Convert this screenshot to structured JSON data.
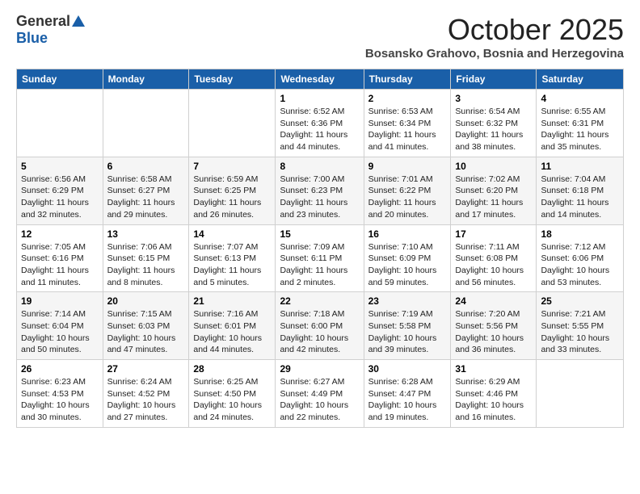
{
  "header": {
    "logo_general": "General",
    "logo_blue": "Blue",
    "month_title": "October 2025",
    "subtitle": "Bosansko Grahovo, Bosnia and Herzegovina"
  },
  "weekdays": [
    "Sunday",
    "Monday",
    "Tuesday",
    "Wednesday",
    "Thursday",
    "Friday",
    "Saturday"
  ],
  "weeks": [
    [
      {
        "day": "",
        "sunrise": "",
        "sunset": "",
        "daylight": ""
      },
      {
        "day": "",
        "sunrise": "",
        "sunset": "",
        "daylight": ""
      },
      {
        "day": "",
        "sunrise": "",
        "sunset": "",
        "daylight": ""
      },
      {
        "day": "1",
        "sunrise": "Sunrise: 6:52 AM",
        "sunset": "Sunset: 6:36 PM",
        "daylight": "Daylight: 11 hours and 44 minutes."
      },
      {
        "day": "2",
        "sunrise": "Sunrise: 6:53 AM",
        "sunset": "Sunset: 6:34 PM",
        "daylight": "Daylight: 11 hours and 41 minutes."
      },
      {
        "day": "3",
        "sunrise": "Sunrise: 6:54 AM",
        "sunset": "Sunset: 6:32 PM",
        "daylight": "Daylight: 11 hours and 38 minutes."
      },
      {
        "day": "4",
        "sunrise": "Sunrise: 6:55 AM",
        "sunset": "Sunset: 6:31 PM",
        "daylight": "Daylight: 11 hours and 35 minutes."
      }
    ],
    [
      {
        "day": "5",
        "sunrise": "Sunrise: 6:56 AM",
        "sunset": "Sunset: 6:29 PM",
        "daylight": "Daylight: 11 hours and 32 minutes."
      },
      {
        "day": "6",
        "sunrise": "Sunrise: 6:58 AM",
        "sunset": "Sunset: 6:27 PM",
        "daylight": "Daylight: 11 hours and 29 minutes."
      },
      {
        "day": "7",
        "sunrise": "Sunrise: 6:59 AM",
        "sunset": "Sunset: 6:25 PM",
        "daylight": "Daylight: 11 hours and 26 minutes."
      },
      {
        "day": "8",
        "sunrise": "Sunrise: 7:00 AM",
        "sunset": "Sunset: 6:23 PM",
        "daylight": "Daylight: 11 hours and 23 minutes."
      },
      {
        "day": "9",
        "sunrise": "Sunrise: 7:01 AM",
        "sunset": "Sunset: 6:22 PM",
        "daylight": "Daylight: 11 hours and 20 minutes."
      },
      {
        "day": "10",
        "sunrise": "Sunrise: 7:02 AM",
        "sunset": "Sunset: 6:20 PM",
        "daylight": "Daylight: 11 hours and 17 minutes."
      },
      {
        "day": "11",
        "sunrise": "Sunrise: 7:04 AM",
        "sunset": "Sunset: 6:18 PM",
        "daylight": "Daylight: 11 hours and 14 minutes."
      }
    ],
    [
      {
        "day": "12",
        "sunrise": "Sunrise: 7:05 AM",
        "sunset": "Sunset: 6:16 PM",
        "daylight": "Daylight: 11 hours and 11 minutes."
      },
      {
        "day": "13",
        "sunrise": "Sunrise: 7:06 AM",
        "sunset": "Sunset: 6:15 PM",
        "daylight": "Daylight: 11 hours and 8 minutes."
      },
      {
        "day": "14",
        "sunrise": "Sunrise: 7:07 AM",
        "sunset": "Sunset: 6:13 PM",
        "daylight": "Daylight: 11 hours and 5 minutes."
      },
      {
        "day": "15",
        "sunrise": "Sunrise: 7:09 AM",
        "sunset": "Sunset: 6:11 PM",
        "daylight": "Daylight: 11 hours and 2 minutes."
      },
      {
        "day": "16",
        "sunrise": "Sunrise: 7:10 AM",
        "sunset": "Sunset: 6:09 PM",
        "daylight": "Daylight: 10 hours and 59 minutes."
      },
      {
        "day": "17",
        "sunrise": "Sunrise: 7:11 AM",
        "sunset": "Sunset: 6:08 PM",
        "daylight": "Daylight: 10 hours and 56 minutes."
      },
      {
        "day": "18",
        "sunrise": "Sunrise: 7:12 AM",
        "sunset": "Sunset: 6:06 PM",
        "daylight": "Daylight: 10 hours and 53 minutes."
      }
    ],
    [
      {
        "day": "19",
        "sunrise": "Sunrise: 7:14 AM",
        "sunset": "Sunset: 6:04 PM",
        "daylight": "Daylight: 10 hours and 50 minutes."
      },
      {
        "day": "20",
        "sunrise": "Sunrise: 7:15 AM",
        "sunset": "Sunset: 6:03 PM",
        "daylight": "Daylight: 10 hours and 47 minutes."
      },
      {
        "day": "21",
        "sunrise": "Sunrise: 7:16 AM",
        "sunset": "Sunset: 6:01 PM",
        "daylight": "Daylight: 10 hours and 44 minutes."
      },
      {
        "day": "22",
        "sunrise": "Sunrise: 7:18 AM",
        "sunset": "Sunset: 6:00 PM",
        "daylight": "Daylight: 10 hours and 42 minutes."
      },
      {
        "day": "23",
        "sunrise": "Sunrise: 7:19 AM",
        "sunset": "Sunset: 5:58 PM",
        "daylight": "Daylight: 10 hours and 39 minutes."
      },
      {
        "day": "24",
        "sunrise": "Sunrise: 7:20 AM",
        "sunset": "Sunset: 5:56 PM",
        "daylight": "Daylight: 10 hours and 36 minutes."
      },
      {
        "day": "25",
        "sunrise": "Sunrise: 7:21 AM",
        "sunset": "Sunset: 5:55 PM",
        "daylight": "Daylight: 10 hours and 33 minutes."
      }
    ],
    [
      {
        "day": "26",
        "sunrise": "Sunrise: 6:23 AM",
        "sunset": "Sunset: 4:53 PM",
        "daylight": "Daylight: 10 hours and 30 minutes."
      },
      {
        "day": "27",
        "sunrise": "Sunrise: 6:24 AM",
        "sunset": "Sunset: 4:52 PM",
        "daylight": "Daylight: 10 hours and 27 minutes."
      },
      {
        "day": "28",
        "sunrise": "Sunrise: 6:25 AM",
        "sunset": "Sunset: 4:50 PM",
        "daylight": "Daylight: 10 hours and 24 minutes."
      },
      {
        "day": "29",
        "sunrise": "Sunrise: 6:27 AM",
        "sunset": "Sunset: 4:49 PM",
        "daylight": "Daylight: 10 hours and 22 minutes."
      },
      {
        "day": "30",
        "sunrise": "Sunrise: 6:28 AM",
        "sunset": "Sunset: 4:47 PM",
        "daylight": "Daylight: 10 hours and 19 minutes."
      },
      {
        "day": "31",
        "sunrise": "Sunrise: 6:29 AM",
        "sunset": "Sunset: 4:46 PM",
        "daylight": "Daylight: 10 hours and 16 minutes."
      },
      {
        "day": "",
        "sunrise": "",
        "sunset": "",
        "daylight": ""
      }
    ]
  ]
}
